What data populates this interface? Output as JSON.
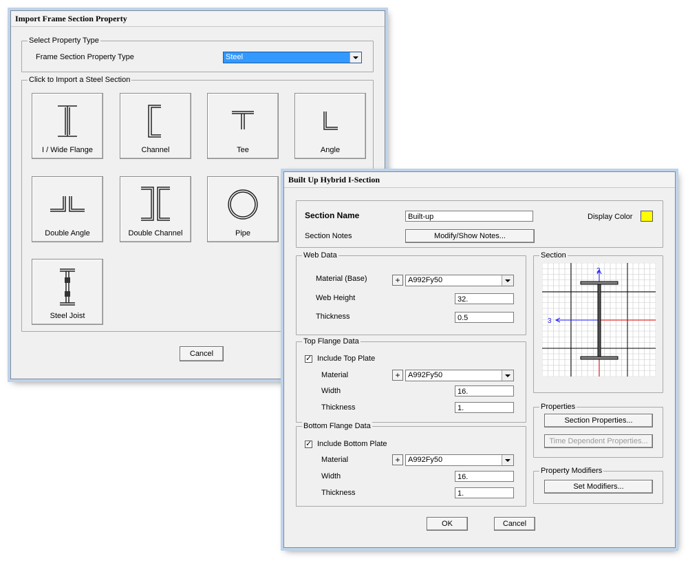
{
  "import_dialog": {
    "title": "Import Frame Section Property",
    "select_group_label": "Select Property Type",
    "property_type_label": "Frame Section Property Type",
    "property_type_value": "Steel",
    "import_group_label": "Click to Import a Steel Section",
    "tiles": [
      {
        "label": "I / Wide Flange",
        "icon": "i-beam-icon"
      },
      {
        "label": "Channel",
        "icon": "channel-icon"
      },
      {
        "label": "Tee",
        "icon": "tee-icon"
      },
      {
        "label": "Angle",
        "icon": "angle-icon"
      },
      {
        "label": "Double Angle",
        "icon": "double-angle-icon"
      },
      {
        "label": "Double Channel",
        "icon": "double-channel-icon"
      },
      {
        "label": "Pipe",
        "icon": "pipe-icon"
      },
      {
        "label": "Steel Joist",
        "icon": "steel-joist-icon"
      }
    ],
    "cancel_label": "Cancel"
  },
  "builtup_dialog": {
    "title": "Built Up Hybrid I-Section",
    "section_name_label": "Section Name",
    "section_name_value": "Built-up",
    "display_color_label": "Display Color",
    "display_color": "#ffff00",
    "section_notes_label": "Section Notes",
    "notes_button": "Modify/Show Notes...",
    "web": {
      "group_label": "Web Data",
      "material_label": "Material (Base)",
      "material_value": "A992Fy50",
      "height_label": "Web Height",
      "height_value": "32.",
      "thickness_label": "Thickness",
      "thickness_value": "0.5"
    },
    "top_flange": {
      "group_label": "Top Flange Data",
      "include_label": "Include Top Plate",
      "material_label": "Material",
      "material_value": "A992Fy50",
      "width_label": "Width",
      "width_value": "16.",
      "thickness_label": "Thickness",
      "thickness_value": "1."
    },
    "bottom_flange": {
      "group_label": "Bottom Flange Data",
      "include_label": "Include Bottom Plate",
      "material_label": "Material",
      "material_value": "A992Fy50",
      "width_label": "Width",
      "width_value": "16.",
      "thickness_label": "Thickness",
      "thickness_value": "1."
    },
    "plus_label": "+",
    "section_group_label": "Section",
    "axis_2_label": "2",
    "axis_3_label": "3",
    "properties_group_label": "Properties",
    "section_properties_button": "Section Properties...",
    "time_dependent_button": "Time Dependent Properties...",
    "modifiers_group_label": "Property Modifiers",
    "set_modifiers_button": "Set Modifiers...",
    "ok_label": "OK",
    "cancel_label": "Cancel"
  }
}
